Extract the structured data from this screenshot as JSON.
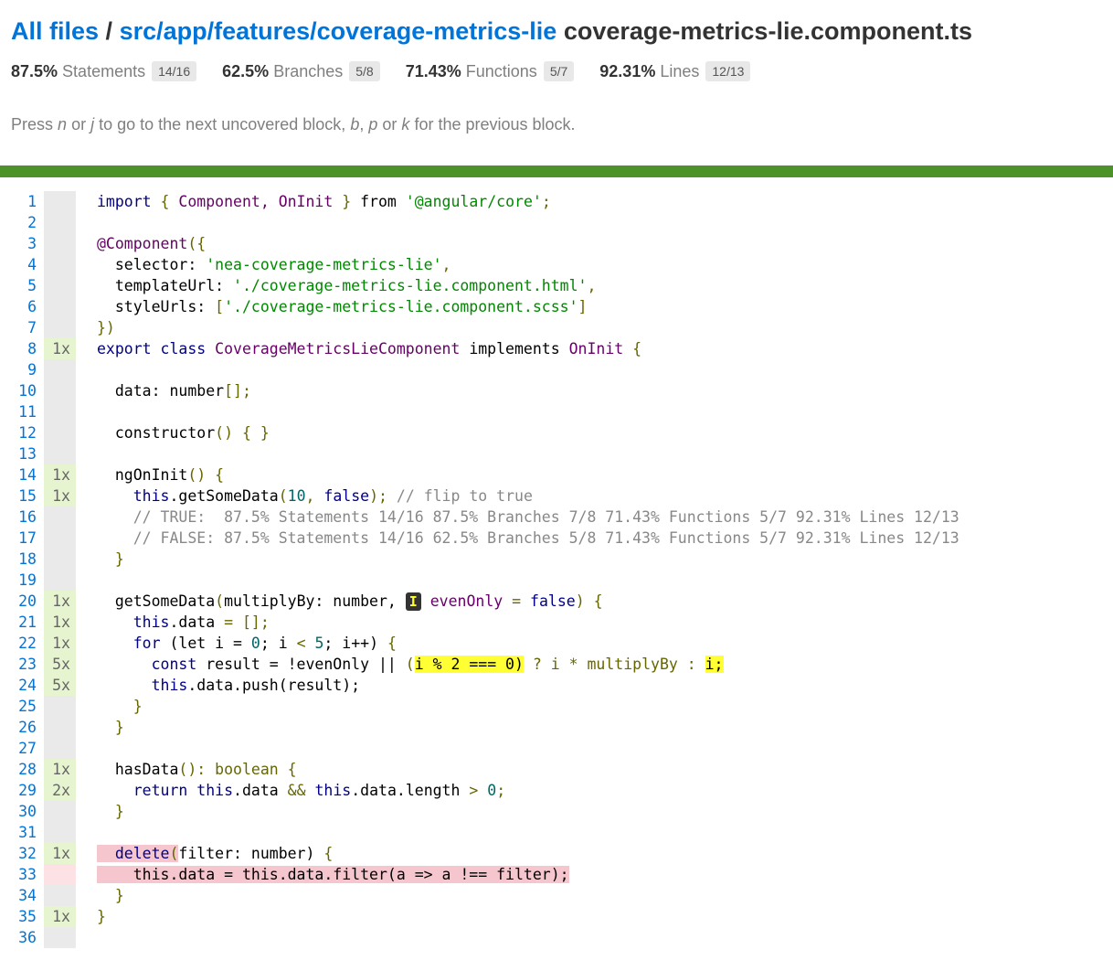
{
  "breadcrumb": {
    "all_files": "All files",
    "separator": "/",
    "folder": "src/app/features/coverage-metrics-lie",
    "file": "coverage-metrics-lie.component.ts"
  },
  "metrics": [
    {
      "pct": "87.5%",
      "label": "Statements",
      "fraction": "14/16"
    },
    {
      "pct": "62.5%",
      "label": "Branches",
      "fraction": "5/8"
    },
    {
      "pct": "71.43%",
      "label": "Functions",
      "fraction": "5/7"
    },
    {
      "pct": "92.31%",
      "label": "Lines",
      "fraction": "12/13"
    }
  ],
  "hint": {
    "press": "Press",
    "n": "n",
    "or1": "or",
    "j": "j",
    "mid": "to go to the next uncovered block,",
    "b": "b",
    "comma": ",",
    "p": "p",
    "or2": "or",
    "k": "k",
    "end": "for the previous block."
  },
  "colors": {
    "link": "#0074d9",
    "status_bar": "#4d9129",
    "covered": "#e6f5d0",
    "uncovered": "#f6c6ce",
    "branch_highlight": "#ffff33"
  },
  "branch_marker": "I",
  "lines": [
    {
      "n": "1",
      "c": ""
    },
    {
      "n": "2",
      "c": ""
    },
    {
      "n": "3",
      "c": ""
    },
    {
      "n": "4",
      "c": ""
    },
    {
      "n": "5",
      "c": ""
    },
    {
      "n": "6",
      "c": ""
    },
    {
      "n": "7",
      "c": ""
    },
    {
      "n": "8",
      "c": "1x"
    },
    {
      "n": "9",
      "c": ""
    },
    {
      "n": "10",
      "c": ""
    },
    {
      "n": "11",
      "c": ""
    },
    {
      "n": "12",
      "c": ""
    },
    {
      "n": "13",
      "c": ""
    },
    {
      "n": "14",
      "c": "1x"
    },
    {
      "n": "15",
      "c": "1x"
    },
    {
      "n": "16",
      "c": ""
    },
    {
      "n": "17",
      "c": ""
    },
    {
      "n": "18",
      "c": ""
    },
    {
      "n": "19",
      "c": ""
    },
    {
      "n": "20",
      "c": "1x"
    },
    {
      "n": "21",
      "c": "1x"
    },
    {
      "n": "22",
      "c": "1x"
    },
    {
      "n": "23",
      "c": "5x"
    },
    {
      "n": "24",
      "c": "5x"
    },
    {
      "n": "25",
      "c": ""
    },
    {
      "n": "26",
      "c": ""
    },
    {
      "n": "27",
      "c": ""
    },
    {
      "n": "28",
      "c": "1x"
    },
    {
      "n": "29",
      "c": "2x"
    },
    {
      "n": "30",
      "c": ""
    },
    {
      "n": "31",
      "c": ""
    },
    {
      "n": "32",
      "c": "1x"
    },
    {
      "n": "33",
      "c": ""
    },
    {
      "n": "34",
      "c": ""
    },
    {
      "n": "35",
      "c": "1x"
    },
    {
      "n": "36",
      "c": ""
    }
  ],
  "code": {
    "import_kw": "import",
    "import_open": "{",
    "import_names": "Component, OnInit",
    "import_close": "}",
    "from_kw": "from",
    "import_path": "'@angular/core'",
    "semi": ";",
    "decorator": "@Component",
    "decorator_open": "({",
    "selector_key": "selector:",
    "selector_val": "'nea-coverage-metrics-lie'",
    "comma": ",",
    "template_key": "templateUrl:",
    "template_val": "'./coverage-metrics-lie.component.html'",
    "style_key": "styleUrls:",
    "style_open": "[",
    "style_val": "'./coverage-metrics-lie.component.scss'",
    "style_close": "]",
    "decorator_close": "})",
    "export_kw": "export",
    "class_kw": "class",
    "class_name": "CoverageMetricsLieComponent",
    "implements_kw": "implements",
    "iface": "OnInit",
    "brace_open": "{",
    "brace_close": "}",
    "data_decl": "data:",
    "data_type": "number",
    "data_brackets": "[];",
    "ctor": "constructor",
    "ctor_rest": "() { }",
    "ngoninit": "ngOnInit",
    "parens": "()",
    "this_kw": "this",
    "get_call": ".getSomeData",
    "paren_open": "(",
    "ten": "10",
    "call_comma": ",",
    "false_kw": "false",
    "call_close": ");",
    "flip_comment": "// flip to true",
    "true_comment": "// TRUE:  87.5% Statements 14/16 87.5% Branches 7/8 71.43% Functions 5/7 92.31% Lines 12/13",
    "false_comment": "// FALSE: 87.5% Statements 14/16 62.5% Branches 5/8 71.43% Functions 5/7 92.31% Lines 12/13",
    "getsome": "getSomeData",
    "params1": "multiplyBy: number,",
    "even_param": "evenOnly",
    "eq": "=",
    "get_close": ")",
    "dot_data": ".data",
    "empty_arr": "[];",
    "for_kw": "for",
    "for_open": "(let i =",
    "zero": "0",
    "for_mid": "; i",
    "lt": "<",
    "five": "5",
    "for_end": "; i++)",
    "const_kw": "const",
    "result_assign": "result = !evenOnly ||",
    "cond_open": "(",
    "cond": "i % 2 === 0)",
    "ternary": "? i * multiplyBy :",
    "else_branch": "i;",
    "push_call": ".data.push(result);",
    "hasdata": "hasData",
    "bool_type": "(): boolean",
    "return_kw": "return",
    "and_op": "&&",
    "length": ".data.length",
    "gt": ">",
    "delete_fn": "delete",
    "filter_params": "filter: number)",
    "filter_line": "this.data = this.data.filter(a => a !== filter);"
  }
}
